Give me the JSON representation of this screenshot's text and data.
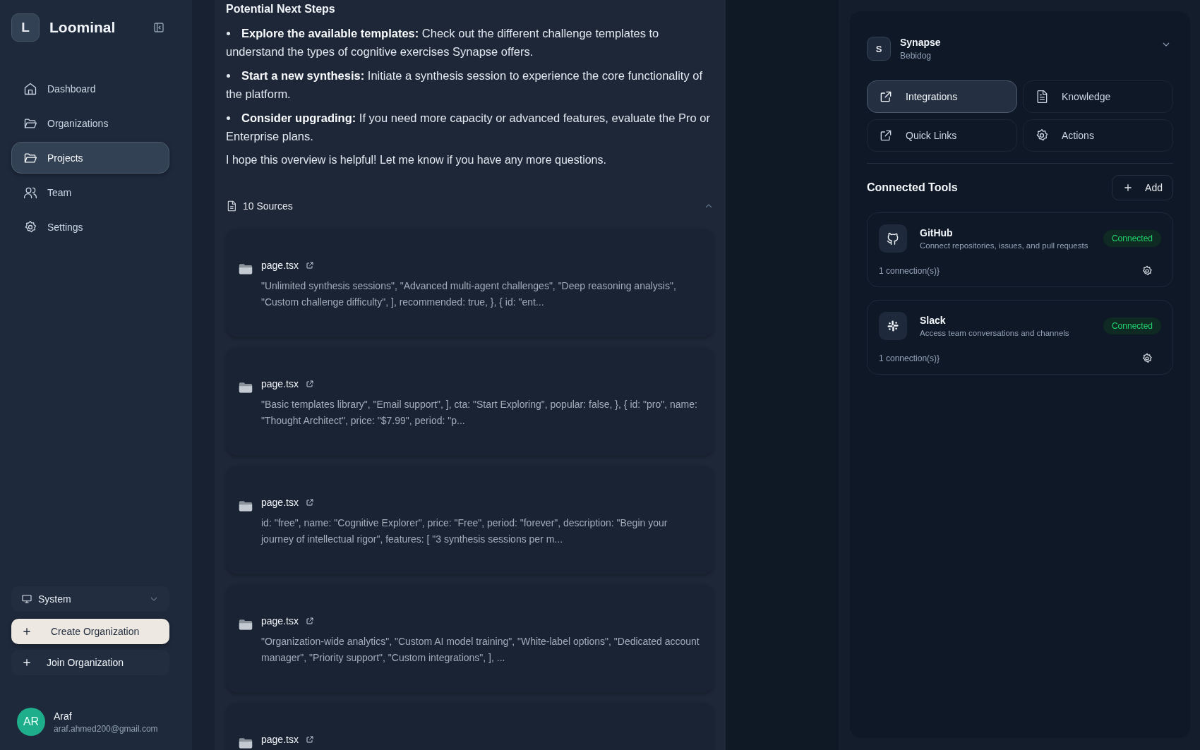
{
  "sidebar": {
    "logo_letter": "L",
    "brand": "Loominal",
    "nav": [
      {
        "label": "Dashboard",
        "selected": false
      },
      {
        "label": "Organizations",
        "selected": false
      },
      {
        "label": "Projects",
        "selected": true
      },
      {
        "label": "Team",
        "selected": false
      },
      {
        "label": "Settings",
        "selected": false
      }
    ],
    "theme_select": {
      "value": "System"
    },
    "buttons": [
      {
        "label": "Create Organization",
        "kind": "primary"
      },
      {
        "label": "Join Organization",
        "kind": "secondary"
      }
    ],
    "user": {
      "initials": "AR",
      "name": "Araf",
      "email": "araf.ahmed200@gmail.com"
    }
  },
  "chat": {
    "heading": "Potential Next Steps",
    "bullets": [
      "**Explore the available templates:** Check out the different challenge templates to understand the types of cognitive exercises Synapse offers.",
      "**Start a new synthesis:** Initiate a synthesis session to experience the core functionality of the platform.",
      "**Consider upgrading:** If you need more capacity or advanced features, evaluate the Pro or Enterprise plans."
    ],
    "closing": "I hope this overview is helpful! Let me know if you have any more questions.",
    "sources": {
      "label": "10 Sources",
      "expanded": true,
      "items": [
        {
          "name": "page.tsx",
          "snippet": "\"Unlimited synthesis sessions\", \"Advanced multi-agent challenges\", \"Deep reasoning analysis\", \"Custom challenge difficulty\", ], recommended: true, }, { id: \"ent..."
        },
        {
          "name": "page.tsx",
          "snippet": "\"Basic templates library\", \"Email support\", ], cta: \"Start Exploring\", popular: false, }, { id: \"pro\", name: \"Thought Architect\", price: \"$7.99\", period: \"p..."
        },
        {
          "name": "page.tsx",
          "snippet": "id: \"free\", name: \"Cognitive Explorer\", price: \"Free\", period: \"forever\", description: \"Begin your journey of intellectual rigor\", features: [ \"3 synthesis sessions per m..."
        },
        {
          "name": "page.tsx",
          "snippet": "\"Organization-wide analytics\", \"Custom AI model training\", \"White-label options\", \"Dedicated account manager\", \"Priority support\", \"Custom integrations\", ], ..."
        },
        {
          "name": "page.tsx"
        }
      ]
    }
  },
  "panel": {
    "project": {
      "initial": "S",
      "name": "Synapse",
      "org": "Bebidog"
    },
    "tabs": [
      {
        "label": "Integrations",
        "selected": true
      },
      {
        "label": "Knowledge",
        "selected": false
      },
      {
        "label": "Quick Links",
        "selected": false
      },
      {
        "label": "Actions",
        "selected": false
      }
    ],
    "section_title": "Connected Tools",
    "add_button": "Add",
    "tools": [
      {
        "name": "GitHub",
        "description": "Connect repositories, issues, and pull requests",
        "status": "Connected",
        "connections": "1 connection(s)}"
      },
      {
        "name": "Slack",
        "description": "Access team conversations and channels",
        "status": "Connected",
        "connections": "1 connection(s)}"
      }
    ]
  }
}
